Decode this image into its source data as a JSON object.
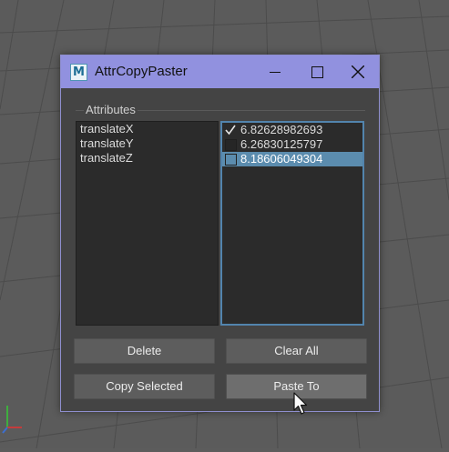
{
  "window": {
    "title": "AttrCopyPaster",
    "icon_letter": "M",
    "icon": "maya-app-icon"
  },
  "group": {
    "label": "Attributes"
  },
  "attributes": [
    "translateX",
    "translateY",
    "translateZ"
  ],
  "values": [
    {
      "value": "6.82628982693",
      "checked": true,
      "selected": false
    },
    {
      "value": "6.26830125797",
      "checked": false,
      "selected": false
    },
    {
      "value": "8.18606049304",
      "checked": false,
      "selected": true
    }
  ],
  "buttons": {
    "delete": "Delete",
    "clear_all": "Clear All",
    "copy_selected": "Copy Selected",
    "paste_to": "Paste To"
  },
  "colors": {
    "title_bar": "#9191df",
    "selection": "#5b8cae",
    "list_focus_border": "#5284ad",
    "viewport_bg": "#5c5c5c"
  }
}
